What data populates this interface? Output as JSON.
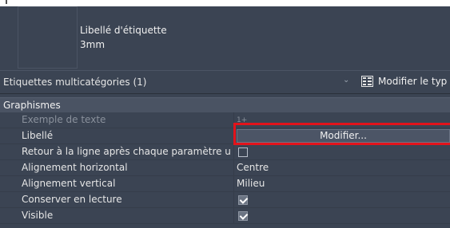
{
  "type_preview": {
    "name": "Libellé d'étiquette",
    "size": "3mm"
  },
  "selector": {
    "label": "Etiquettes multicatégories (1)",
    "edit_type_label": "Modifier le typ"
  },
  "group": {
    "label": "Graphismes"
  },
  "properties": [
    {
      "name": "Exemple de texte",
      "value": "1+",
      "kind": "text",
      "disabled": true
    },
    {
      "name": "Libellé",
      "value": "Modifier...",
      "kind": "button"
    },
    {
      "name": "Retour à la ligne après chaque paramètre u...",
      "checked": false,
      "kind": "checkbox"
    },
    {
      "name": "Alignement horizontal",
      "value": "Centre",
      "kind": "text"
    },
    {
      "name": "Alignement vertical",
      "value": "Milieu",
      "kind": "text"
    },
    {
      "name": "Conserver en lecture",
      "checked": true,
      "kind": "checkbox"
    },
    {
      "name": "Visible",
      "checked": true,
      "kind": "checkbox"
    }
  ],
  "colors": {
    "panel_bg": "#3b4453",
    "highlight": "#e3131b"
  },
  "icons": {
    "selector_dropdown": "chevron-down-icon",
    "edit_type": "edit-type-icon",
    "checkbox": "checkmark-icon"
  }
}
